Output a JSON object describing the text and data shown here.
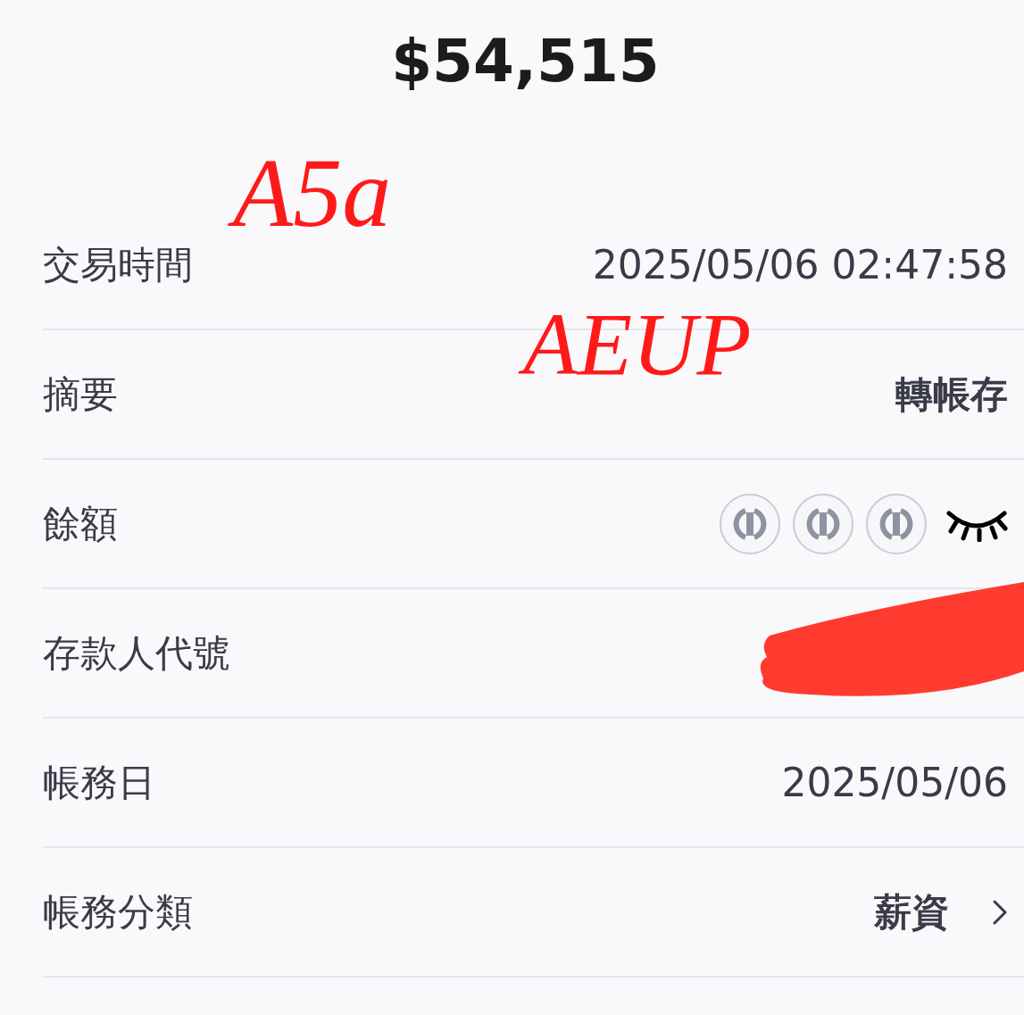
{
  "amount": "$54,515",
  "rows": [
    {
      "kind": "text",
      "label": "交易時間",
      "value": "2025/05/06 02:47:58"
    },
    {
      "kind": "bold",
      "label": "摘要",
      "value": "轉帳存"
    },
    {
      "kind": "masked",
      "label": "餘額"
    },
    {
      "kind": "redacted",
      "label": "存款人代號"
    },
    {
      "kind": "text",
      "label": "帳務日",
      "value": "2025/05/06"
    },
    {
      "kind": "link",
      "label": "帳務分類",
      "value": "薪資"
    }
  ],
  "annotations": [
    {
      "text": "A5a"
    },
    {
      "text": "AEUP"
    }
  ]
}
